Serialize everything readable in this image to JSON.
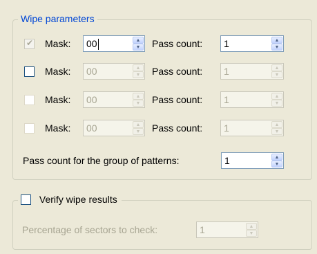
{
  "wipe_group": {
    "title": "Wipe parameters",
    "rows": [
      {
        "checked": true,
        "enabled": false,
        "mask_label": "Mask:",
        "mask_value": "00",
        "pass_label": "Pass count:",
        "pass_value": "1",
        "fields_enabled": true
      },
      {
        "checked": false,
        "enabled": true,
        "mask_label": "Mask:",
        "mask_value": "00",
        "pass_label": "Pass count:",
        "pass_value": "1",
        "fields_enabled": false
      },
      {
        "checked": false,
        "enabled": false,
        "mask_label": "Mask:",
        "mask_value": "00",
        "pass_label": "Pass count:",
        "pass_value": "1",
        "fields_enabled": false
      },
      {
        "checked": false,
        "enabled": false,
        "mask_label": "Mask:",
        "mask_value": "00",
        "pass_label": "Pass count:",
        "pass_value": "1",
        "fields_enabled": false
      }
    ],
    "group_pass_label": "Pass count for the group of patterns:",
    "group_pass_value": "1"
  },
  "verify_group": {
    "checkbox_label": "Verify wipe results",
    "checked": false,
    "percentage_label": "Percentage of sectors to check:",
    "percentage_value": "1"
  },
  "icons": {
    "spin_up": "spin-up-arrow-icon",
    "spin_down": "spin-down-arrow-icon",
    "check": "checkmark-icon"
  }
}
